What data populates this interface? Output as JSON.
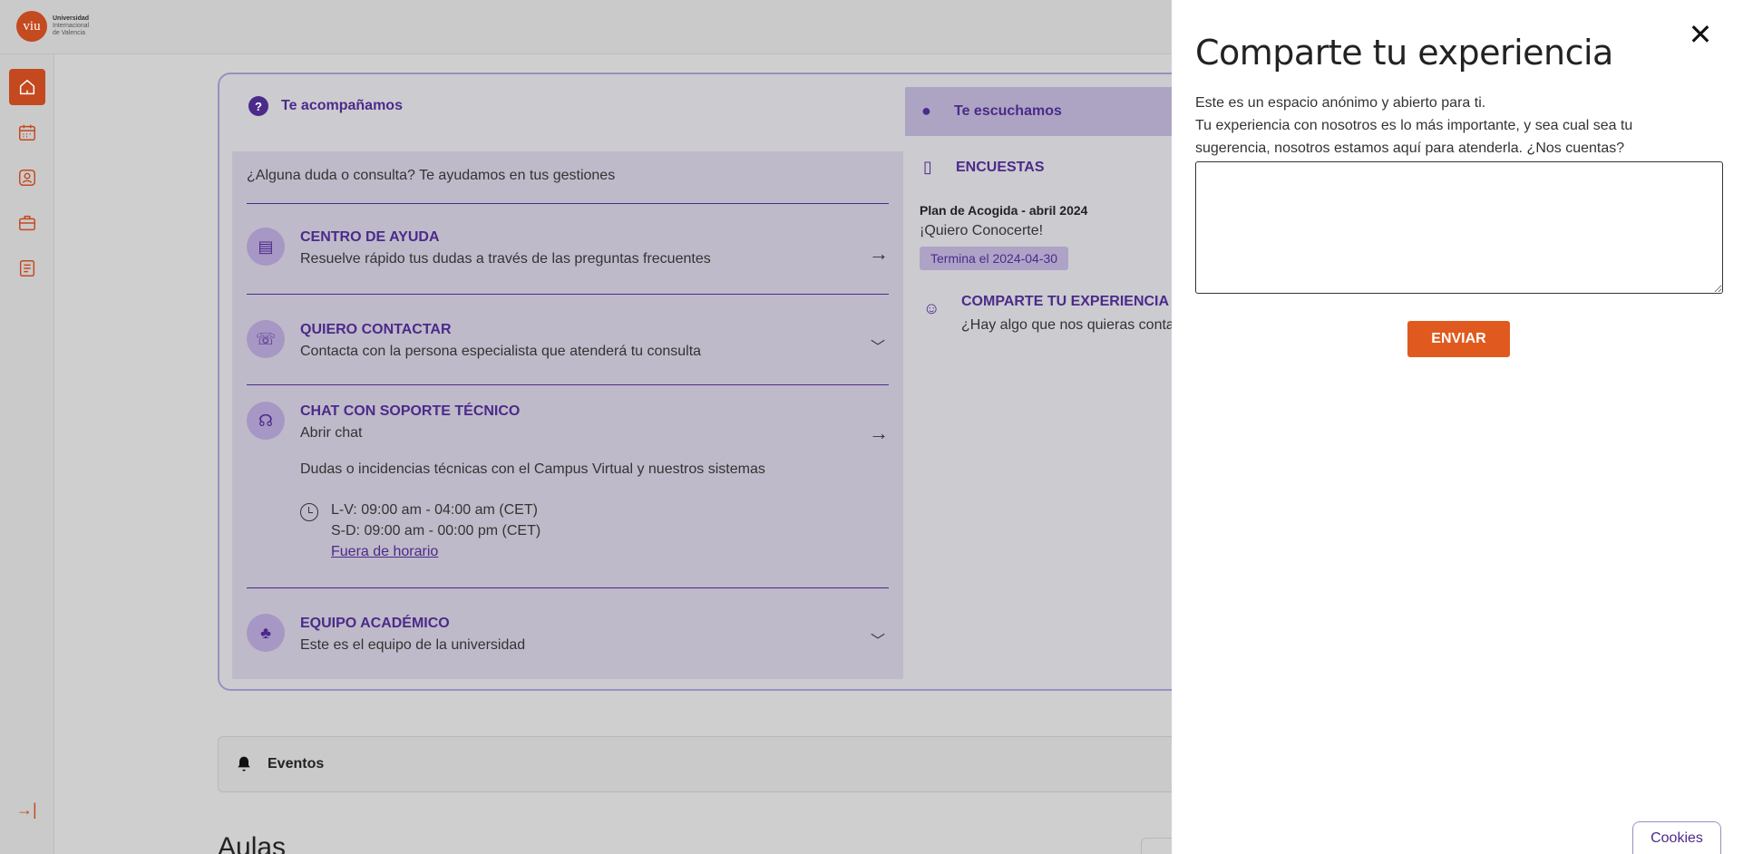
{
  "logo": {
    "mark": "viu",
    "line1": "Universidad",
    "line2": "Internacional",
    "line3": "de Valencia"
  },
  "sidebar": {
    "items": [
      {
        "name": "home-icon",
        "active": true
      },
      {
        "name": "calendar-icon",
        "active": false
      },
      {
        "name": "profile-icon",
        "active": false
      },
      {
        "name": "briefcase-icon",
        "active": false
      },
      {
        "name": "document-icon",
        "active": false
      }
    ],
    "collapse_label": "→|"
  },
  "support": {
    "heading": "Te acompañamos",
    "intro": "¿Alguna duda o consulta? Te ayudamos en tus gestiones",
    "items": [
      {
        "title": "CENTRO DE AYUDA",
        "subtitle": "Resuelve rápido tus dudas a través de las preguntas frecuentes"
      },
      {
        "title": "QUIERO CONTACTAR",
        "subtitle": "Contacta con la persona especialista que atenderá tu consulta"
      },
      {
        "title": "CHAT CON SOPORTE TÉCNICO",
        "subtitle": "Abrir chat",
        "extra": "Dudas o incidencias técnicas con el Campus Virtual y nuestros sistemas",
        "hours": [
          "L-V: 09:00 am - 04:00 am (CET)",
          "S-D: 09:00 am - 00:00 pm (CET)"
        ],
        "hours_link": "Fuera de horario"
      },
      {
        "title": "EQUIPO ACADÉMICO",
        "subtitle": "Este es el equipo de la universidad"
      }
    ]
  },
  "listening": {
    "heading": "Te escuchamos",
    "surveys_heading": "ENCUESTAS",
    "survey_plan": "Plan de Acogida - abril 2024",
    "survey_name": "¡Quiero Conocerte!",
    "survey_badge": "Termina el 2024-04-30",
    "share_title": "COMPARTE TU EXPERIENCIA",
    "share_sub": "¿Hay algo que nos quieras contarnos?"
  },
  "events": {
    "label": "Eventos"
  },
  "aulas": {
    "label": "Aulas"
  },
  "panel": {
    "title": "Comparte tu experiencia",
    "close_label": "✕",
    "desc_line1": "Este es un espacio anónimo y abierto para ti.",
    "desc_line2": "Tu experiencia con nosotros es lo más importante, y sea cual sea tu sugerencia, nosotros estamos aquí para atenderla. ¿Nos cuentas?",
    "textarea_value": "",
    "send_label": "ENVIAR"
  },
  "cookies": {
    "label": "Cookies"
  },
  "colors": {
    "accent": "#c4491e",
    "purple": "#4b2a8a",
    "send": "#e05a1f"
  }
}
